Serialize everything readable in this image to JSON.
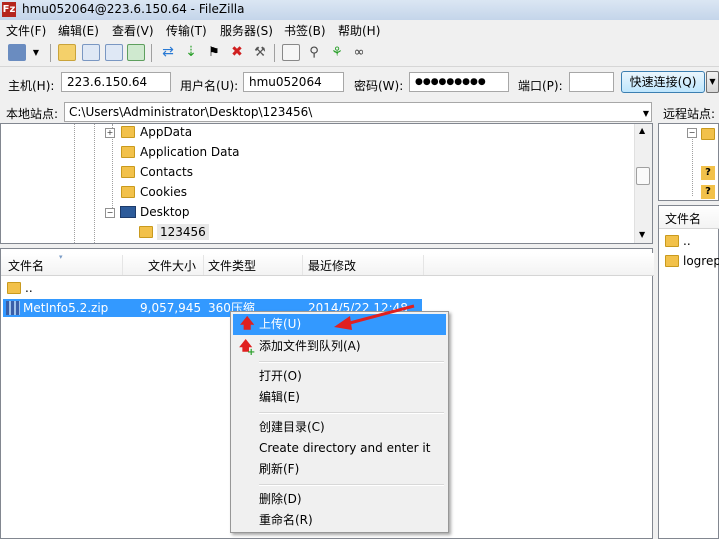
{
  "window": {
    "title": "hmu052064@223.6.150.64 - FileZilla",
    "app_icon": "Fz"
  },
  "menu": [
    "文件(F)",
    "编辑(E)",
    "查看(V)",
    "传输(T)",
    "服务器(S)",
    "书签(B)",
    "帮助(H)"
  ],
  "quickconnect": {
    "host_label": "主机(H):",
    "host_value": "223.6.150.64",
    "user_label": "用户名(U):",
    "user_value": "hmu052064",
    "pass_label": "密码(W):",
    "pass_value": "●●●●●●●●●",
    "port_label": "端口(P):",
    "port_value": "",
    "button_label": "快速连接(Q)"
  },
  "local": {
    "label": "本地站点:",
    "path": "C:\\Users\\Administrator\\Desktop\\123456\\",
    "tree": [
      "AppData",
      "Application Data",
      "Contacts",
      "Cookies",
      "Desktop",
      "123456"
    ],
    "columns": [
      "文件名",
      "文件大小",
      "文件类型",
      "最近修改"
    ],
    "files": [
      {
        "name": ".."
      },
      {
        "name": "MetInfo5.2.zip",
        "size": "9,057,945",
        "type": "360压缩",
        "modified": "2014/5/22 12:48"
      }
    ]
  },
  "remote": {
    "label": "远程站点:",
    "column_name": "文件名",
    "files": [
      "..",
      "logrep"
    ]
  },
  "context_menu": {
    "items": [
      "上传(U)",
      "添加文件到队列(A)",
      "打开(O)",
      "编辑(E)",
      "创建目录(C)",
      "Create directory and enter it",
      "刷新(F)",
      "删除(D)",
      "重命名(R)"
    ]
  },
  "colors": {
    "selection": "#3399ff",
    "folder": "#f2c14a",
    "arrow": "#e02020"
  }
}
